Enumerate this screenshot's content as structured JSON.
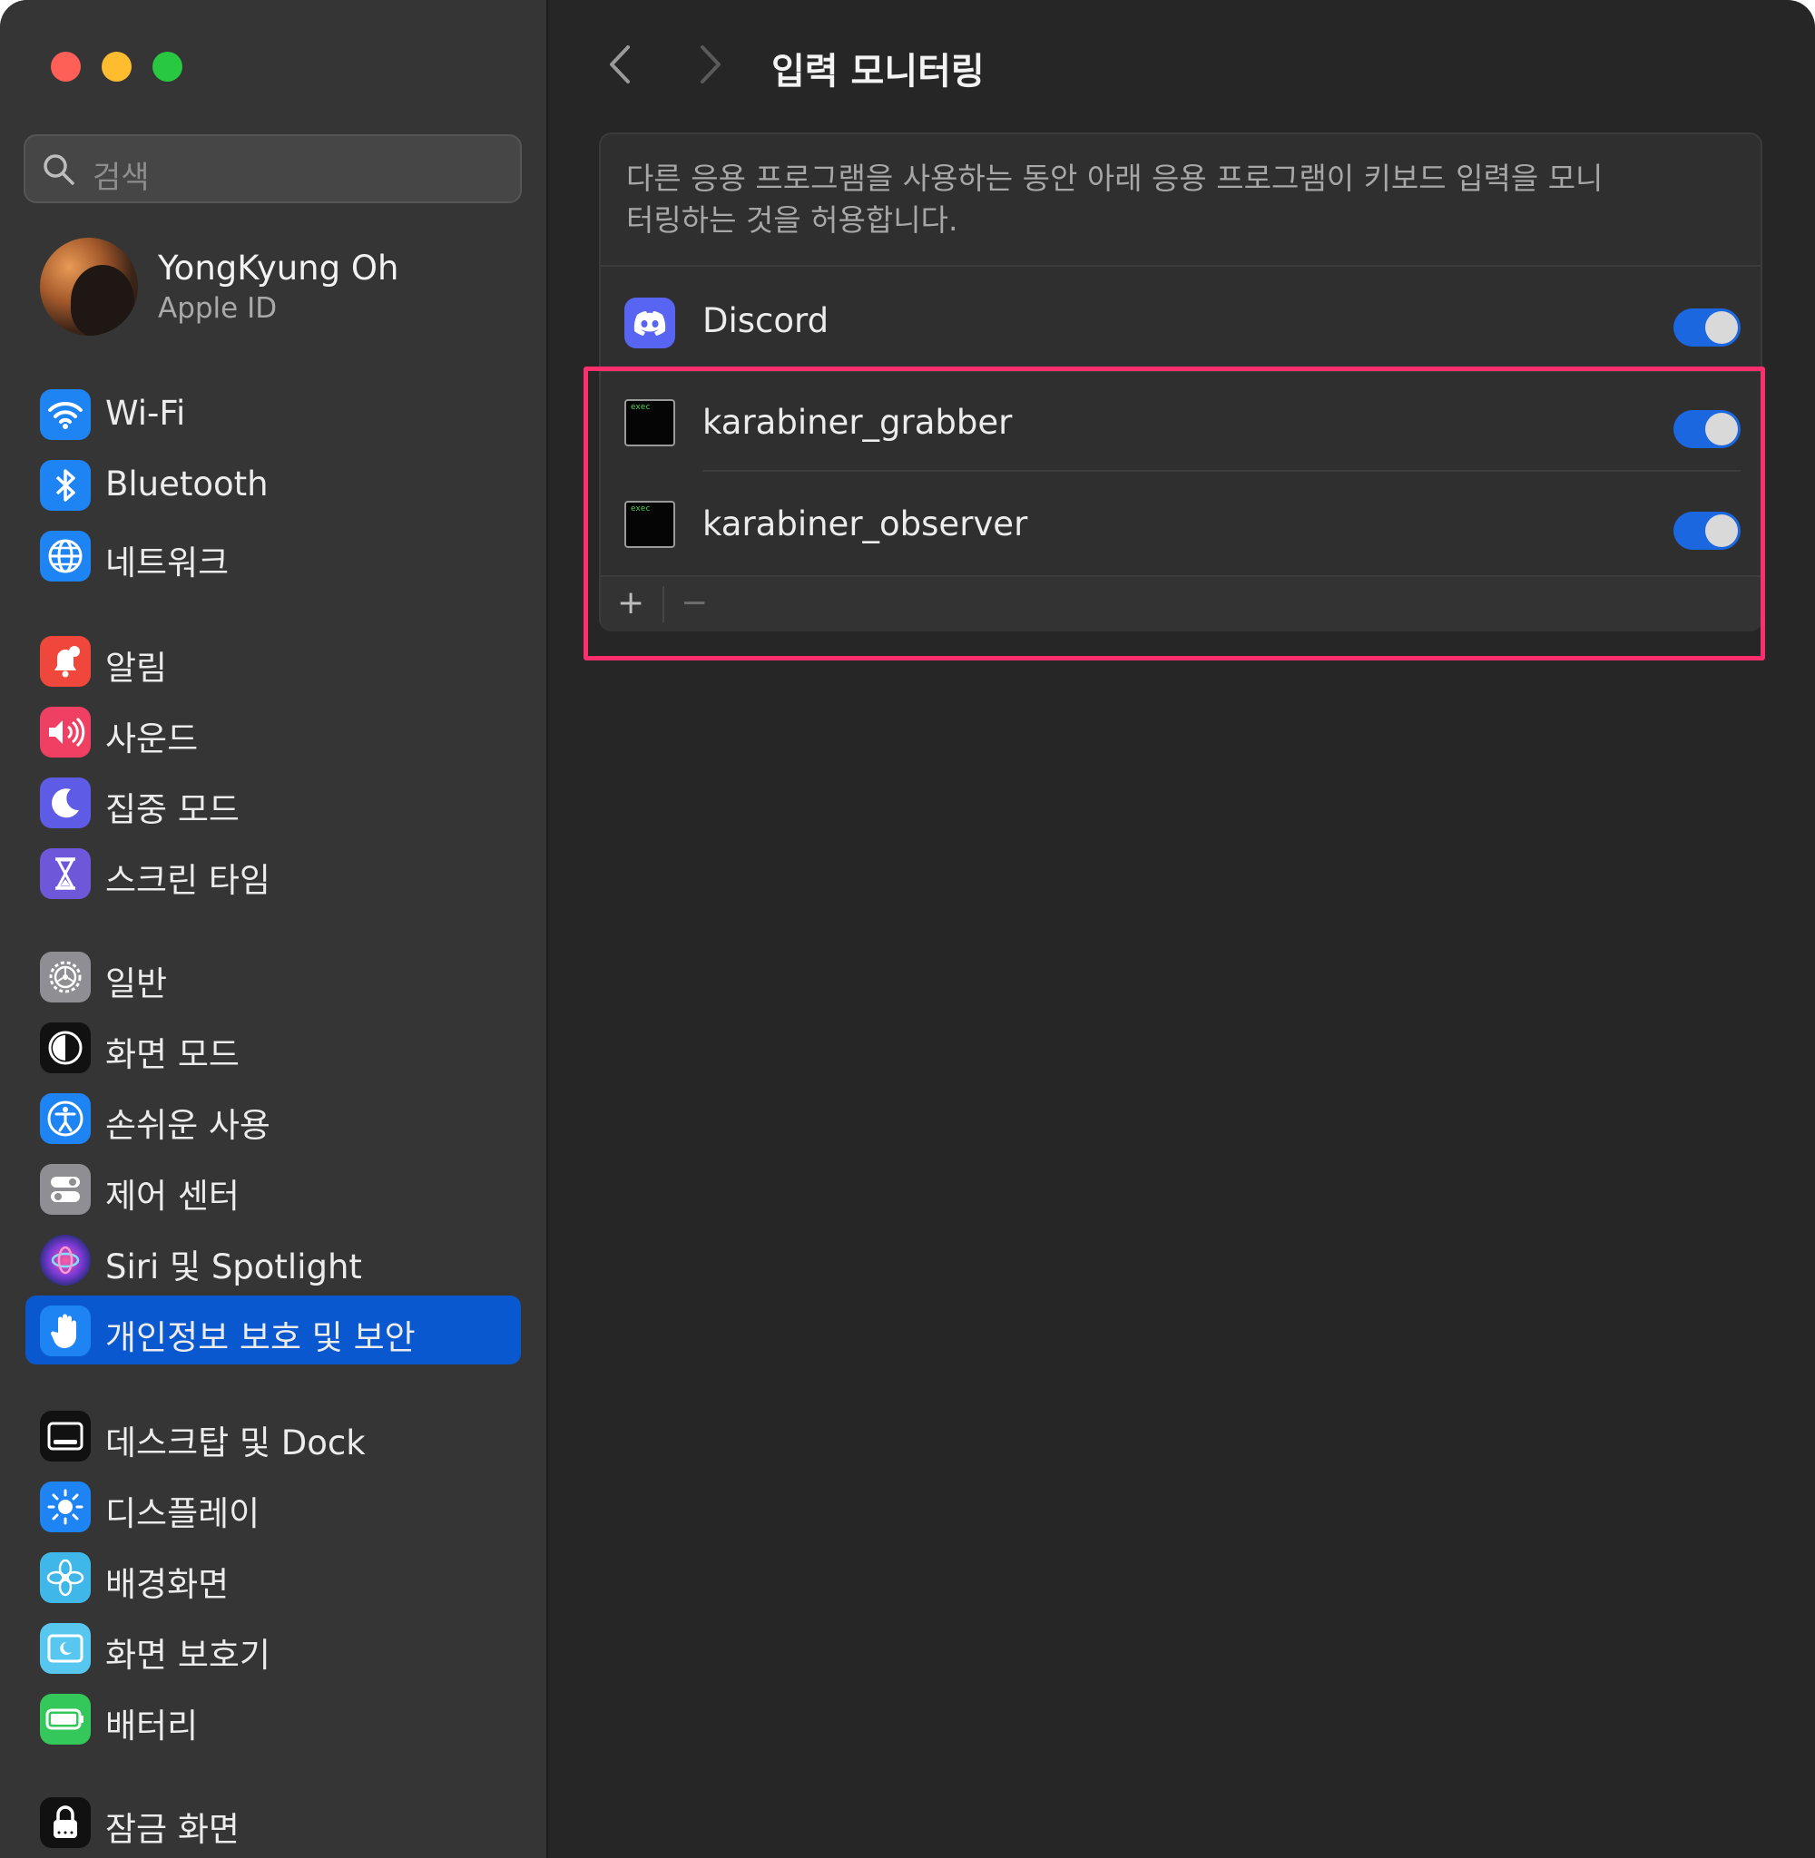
{
  "window": {
    "traffic_lights": [
      "close",
      "minimize",
      "zoom"
    ]
  },
  "sidebar": {
    "search_placeholder": "검색",
    "profile": {
      "name": "YongKyung Oh",
      "subtitle": "Apple ID"
    },
    "items": [
      {
        "label": "Wi-Fi",
        "icon": "wifi-icon",
        "color": "#1e84f3"
      },
      {
        "label": "Bluetooth",
        "icon": "bluetooth-icon",
        "color": "#1e84f3"
      },
      {
        "label": "네트워크",
        "icon": "globe-icon",
        "color": "#1e84f3"
      },
      {
        "label": "알림",
        "icon": "bell-icon",
        "color": "#f0473c"
      },
      {
        "label": "사운드",
        "icon": "speaker-icon",
        "color": "#ef3f63"
      },
      {
        "label": "집중 모드",
        "icon": "moon-icon",
        "color": "#5e5ce6"
      },
      {
        "label": "스크린 타임",
        "icon": "hourglass-icon",
        "color": "#6e57d8"
      },
      {
        "label": "일반",
        "icon": "gear-icon",
        "color": "#8e8e93"
      },
      {
        "label": "화면 모드",
        "icon": "appearance-icon",
        "color": "#111111"
      },
      {
        "label": "손쉬운 사용",
        "icon": "accessibility-icon",
        "color": "#1e84f3"
      },
      {
        "label": "제어 센터",
        "icon": "control-center-icon",
        "color": "#8e8e93"
      },
      {
        "label": "Siri 및 Spotlight",
        "icon": "siri-icon",
        "color": "#5a2d8c"
      },
      {
        "label": "개인정보 보호 및 보안",
        "icon": "hand-icon",
        "color": "#1e84f3",
        "active": true
      },
      {
        "label": "데스크탑 및 Dock",
        "icon": "dock-icon",
        "color": "#111111"
      },
      {
        "label": "디스플레이",
        "icon": "sun-icon",
        "color": "#1e84f3"
      },
      {
        "label": "배경화면",
        "icon": "flower-icon",
        "color": "#3fb7e8"
      },
      {
        "label": "화면 보호기",
        "icon": "screensaver-icon",
        "color": "#57c7f0"
      },
      {
        "label": "배터리",
        "icon": "battery-icon",
        "color": "#34c759"
      },
      {
        "label": "잠금 화면",
        "icon": "lock-icon",
        "color": "#111111"
      }
    ]
  },
  "main": {
    "title": "입력 모니터링",
    "description": "다른 응용 프로그램을 사용하는 동안 아래 응용 프로그램이 키보드 입력을 모니터링하는 것을 허용합니다.",
    "apps": [
      {
        "name": "Discord",
        "icon": "discord-icon",
        "enabled": true
      },
      {
        "name": "karabiner_grabber",
        "icon": "exec-icon",
        "icon_text": "exec",
        "enabled": true
      },
      {
        "name": "karabiner_observer",
        "icon": "exec-icon",
        "icon_text": "exec",
        "enabled": true
      }
    ],
    "add_label": "+",
    "remove_label": "−"
  }
}
